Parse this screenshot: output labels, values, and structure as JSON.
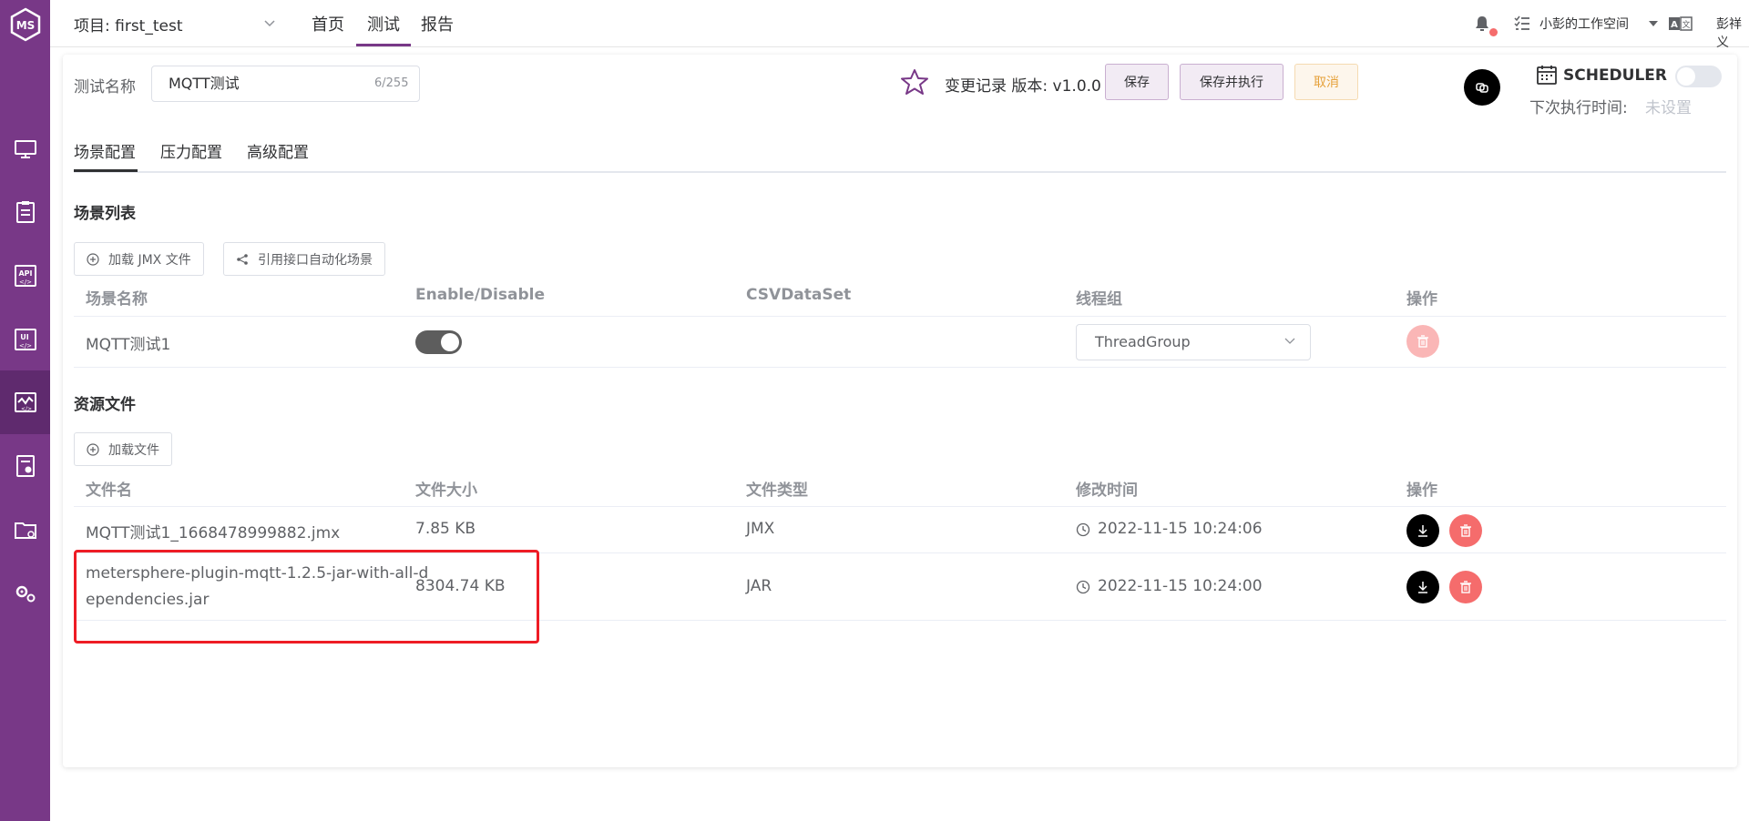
{
  "header": {
    "project_label": "项目: first_test",
    "nav": [
      "首页",
      "测试",
      "报告"
    ],
    "workspace": "小彭的工作空间",
    "user": "彭祥义"
  },
  "toolbar": {
    "test_name_label": "测试名称",
    "test_name_value": "MQTT测试",
    "test_name_count": "6/255",
    "change_log": "变更记录 版本: v1.0.0",
    "save": "保存",
    "save_run": "保存并执行",
    "cancel": "取消",
    "scheduler": "SCHEDULER",
    "next_exec_label": "下次执行时间:",
    "next_exec_value": "未设置"
  },
  "tabs": [
    "场景配置",
    "压力配置",
    "高级配置"
  ],
  "scenes": {
    "title": "场景列表",
    "load_jmx": "加载 JMX 文件",
    "ref_scene": "引用接口自动化场景",
    "columns": [
      "场景名称",
      "Enable/Disable",
      "CSVDataSet",
      "线程组",
      "操作"
    ],
    "rows": [
      {
        "name": "MQTT测试1",
        "thread_group": "ThreadGroup"
      }
    ]
  },
  "files": {
    "title": "资源文件",
    "load_file": "加载文件",
    "columns": [
      "文件名",
      "文件大小",
      "文件类型",
      "修改时间",
      "操作"
    ],
    "rows": [
      {
        "name": "MQTT测试1_1668478999882.jmx",
        "size": "7.85 KB",
        "type": "JMX",
        "time": "2022-11-15 10:24:06"
      },
      {
        "name_line1": "metersphere-plugin-mqtt-1.2.5-jar-with-all-d",
        "name_line2": "ependencies.jar",
        "size": "8304.74 KB",
        "type": "JAR",
        "time": "2022-11-15 10:24:00"
      }
    ]
  }
}
